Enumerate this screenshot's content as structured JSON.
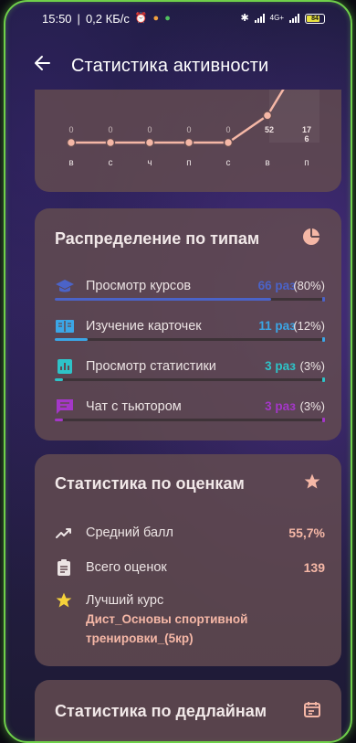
{
  "status_bar": {
    "time": "15:50",
    "speed": "0,2 КБ/с",
    "network": "4G+",
    "battery": "84"
  },
  "app_bar": {
    "title": "Статистика активности"
  },
  "chart_data": {
    "type": "line",
    "categories": [
      "в",
      "с",
      "ч",
      "п",
      "с",
      "в",
      "п"
    ],
    "values": [
      0,
      0,
      0,
      0,
      0,
      52,
      176
    ],
    "value_labels": [
      "0",
      "0",
      "0",
      "0",
      "0",
      "52",
      "176"
    ],
    "color": "#f5b7a6"
  },
  "types": {
    "title": "Распределение по типам",
    "icon": "pie-chart-icon",
    "items": [
      {
        "label": "Просмотр курсов",
        "count": "66 раз",
        "percent": "(80%)",
        "value": 0.8,
        "color": "#4b63c8",
        "icon": "school-icon"
      },
      {
        "label": "Изучение карточек",
        "count": "11 раз",
        "percent": "(12%)",
        "value": 0.12,
        "color": "#3ba6e6",
        "icon": "book-icon"
      },
      {
        "label": "Просмотр статистики",
        "count": "3 раз",
        "percent": "(3%)",
        "value": 0.03,
        "color": "#2ec3c8",
        "icon": "analytics-icon"
      },
      {
        "label": "Чат с тьютором",
        "count": "3 раз",
        "percent": "(3%)",
        "value": 0.03,
        "color": "#a437c8",
        "icon": "chat-icon"
      }
    ]
  },
  "grades": {
    "title": "Статистика по оценкам",
    "icon": "star-icon",
    "average_label": "Средний балл",
    "average_value": "55,7%",
    "total_label": "Всего оценок",
    "total_value": "139",
    "best_label": "Лучший курс",
    "best_value": "Дист_Основы спортивной тренировки_(5кр)"
  },
  "deadlines": {
    "title": "Статистика по дедлайнам",
    "icon": "calendar-icon"
  }
}
